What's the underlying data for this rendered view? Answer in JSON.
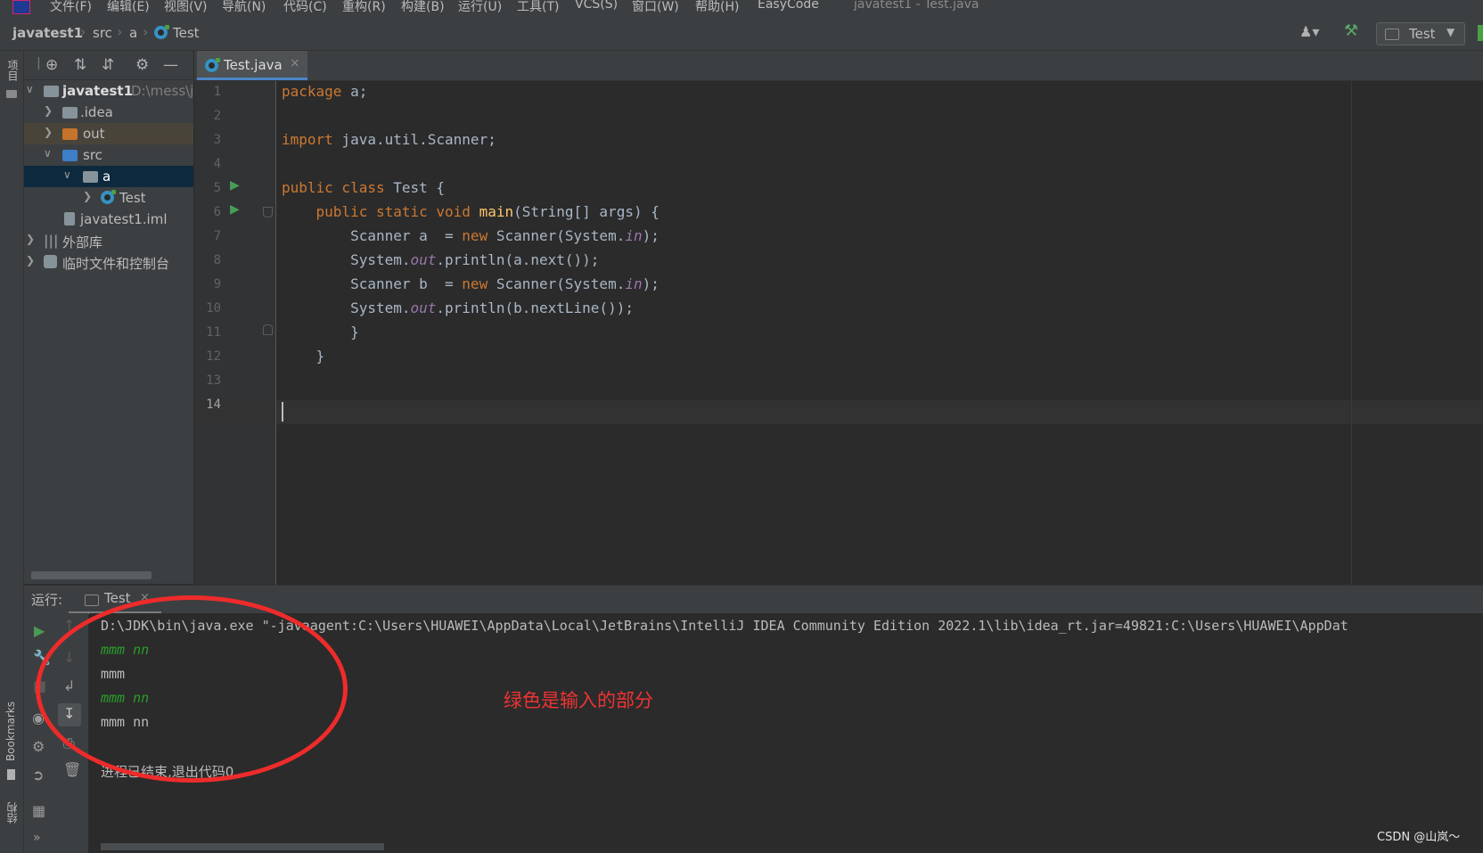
{
  "menu": {
    "items": [
      "文件(F)",
      "编辑(E)",
      "视图(V)",
      "导航(N)",
      "代码(C)",
      "重构(R)",
      "构建(B)",
      "运行(U)",
      "工具(T)",
      "VCS(S)",
      "窗口(W)",
      "帮助(H)",
      "EasyCode"
    ],
    "window_title": "javatest1 - Test.java"
  },
  "navbar": {
    "project": "javatest1",
    "src": "src",
    "pkg": "a",
    "file": "Test",
    "run_config": "Test"
  },
  "left_strip": {
    "project_label": "项目",
    "bookmarks_label": "Bookmarks",
    "structure_label": "结构"
  },
  "project_tree": [
    {
      "label": "javatest1",
      "suffix": "D:\\mess\\j",
      "bold": true
    },
    {
      "label": ".idea"
    },
    {
      "label": "out"
    },
    {
      "label": "src"
    },
    {
      "label": "a"
    },
    {
      "label": "Test"
    },
    {
      "label": "javatest1.iml"
    },
    {
      "label": "外部库"
    },
    {
      "label": "临时文件和控制台"
    }
  ],
  "editor": {
    "tab_label": "Test.java",
    "line_numbers": [
      "1",
      "2",
      "3",
      "4",
      "5",
      "6",
      "7",
      "8",
      "9",
      "10",
      "11",
      "12",
      "13",
      "14"
    ]
  },
  "run": {
    "label": "运行:",
    "tab": "Test",
    "command": "D:\\JDK\\bin\\java.exe \"-javaagent:C:\\Users\\HUAWEI\\AppData\\Local\\JetBrains\\IntelliJ IDEA Community Edition 2022.1\\lib\\idea_rt.jar=49821:C:\\Users\\HUAWEI\\AppDat",
    "lines": [
      {
        "text": "mmm nn",
        "input": true
      },
      {
        "text": "mmm",
        "input": false
      },
      {
        "text": "mmm  nn",
        "input": true
      },
      {
        "text": "mmm  nn",
        "input": false
      }
    ],
    "exit": "进程已结束,退出代码0"
  },
  "annotation": "绿色是输入的部分",
  "watermark": "CSDN @山岚～",
  "colors": {
    "keyword": "#cc7832",
    "function": "#ffc66d",
    "static_field": "#9876aa",
    "input_text": "#2a9e2a",
    "annotation": "#ee2b2b",
    "accent": "#4a88c7"
  }
}
